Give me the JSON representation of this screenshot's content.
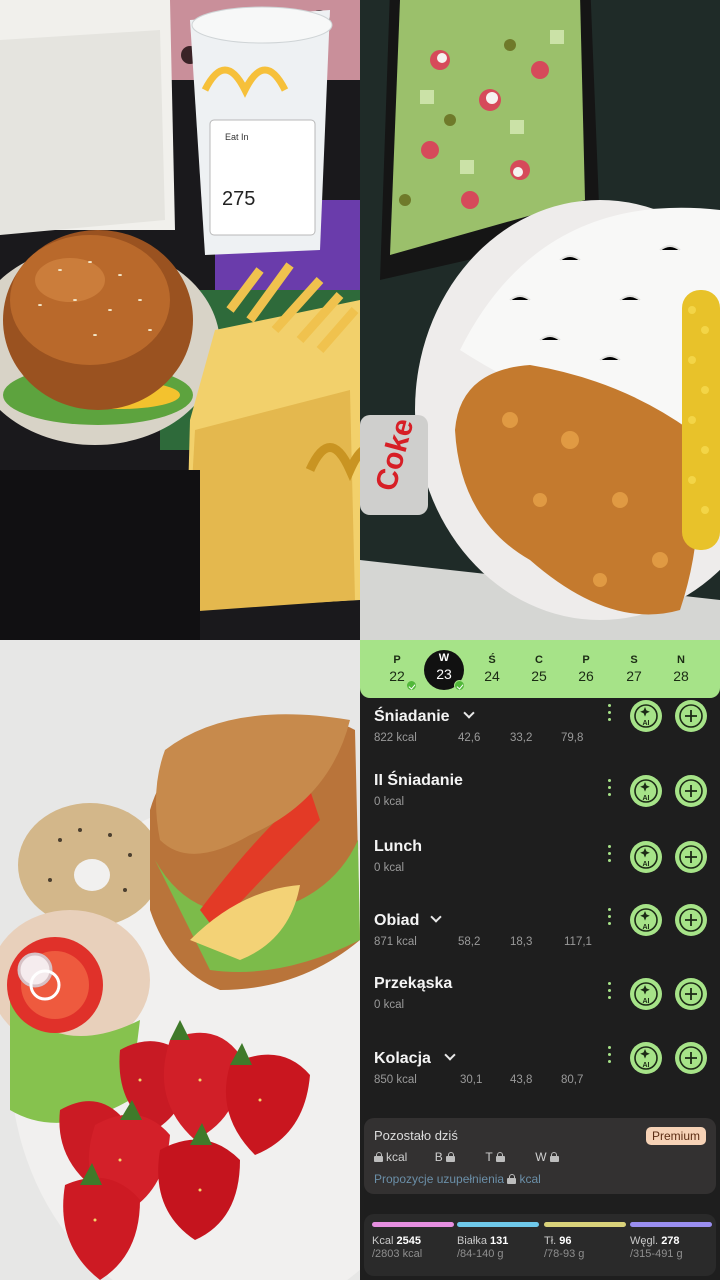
{
  "week": {
    "days": [
      {
        "letter": "P",
        "num": "22",
        "checked": true
      },
      {
        "letter": "W",
        "num": "23",
        "checked": true,
        "selected": true
      },
      {
        "letter": "Ś",
        "num": "24"
      },
      {
        "letter": "C",
        "num": "25"
      },
      {
        "letter": "P",
        "num": "26"
      },
      {
        "letter": "S",
        "num": "27"
      },
      {
        "letter": "N",
        "num": "28"
      }
    ]
  },
  "meals": [
    {
      "name": "Śniadanie",
      "kcal": "822 kcal",
      "p": "42,6",
      "f": "33,2",
      "c": "79,8",
      "expandable": true
    },
    {
      "name": "II Śniadanie",
      "kcal": "0 kcal"
    },
    {
      "name": "Lunch",
      "kcal": "0 kcal"
    },
    {
      "name": "Obiad",
      "kcal": "871 kcal",
      "p": "58,2",
      "f": "18,3",
      "c": "117,1",
      "expandable": true
    },
    {
      "name": "Przekąska",
      "kcal": "0 kcal"
    },
    {
      "name": "Kolacja",
      "kcal": "850 kcal",
      "p": "30,1",
      "f": "43,8",
      "c": "80,7",
      "expandable": true
    }
  ],
  "ai_label": "AI",
  "summary": {
    "title": "Pozostało dziś",
    "premium": "Premium",
    "k": "kcal",
    "b": "B",
    "t": "T",
    "w": "W",
    "suggestion": "Propozycje uzupełnienia",
    "suggestion_unit": "kcal"
  },
  "totals": {
    "kcal": {
      "label": "Kcal",
      "value": "2545",
      "range": "/2803 kcal",
      "color": "#e58fe0"
    },
    "protein": {
      "label": "Białka",
      "value": "131",
      "range": "/84-140 g",
      "color": "#6ec8ea"
    },
    "fat": {
      "label": "Tł.",
      "value": "96",
      "range": "/78-93 g",
      "color": "#d9d27a"
    },
    "carbs": {
      "label": "Węgl.",
      "value": "278",
      "range": "/315-491 g",
      "color": "#9a8ef0"
    }
  },
  "photos": {
    "cup_number": "275",
    "cup_text": "Eat In",
    "can_text": "Coke"
  },
  "colors": {
    "accent": "#a6e388",
    "background": "#1e1e1e"
  }
}
